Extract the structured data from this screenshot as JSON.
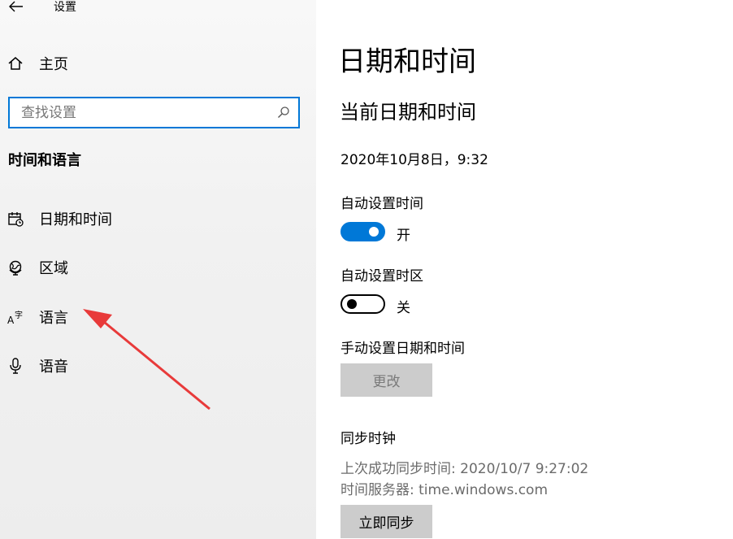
{
  "window": {
    "title": "设置"
  },
  "sidebar": {
    "home_label": "主页",
    "search": {
      "placeholder": "查找设置",
      "value": ""
    },
    "section_title": "时间和语言",
    "items": [
      {
        "label": "日期和时间",
        "icon": "calendar-clock-icon"
      },
      {
        "label": "区域",
        "icon": "globe-region-icon"
      },
      {
        "label": "语言",
        "icon": "language-icon"
      },
      {
        "label": "语音",
        "icon": "microphone-icon"
      }
    ]
  },
  "main": {
    "page_title": "日期和时间",
    "current_section_title": "当前日期和时间",
    "current_datetime": "2020年10月8日，9:32",
    "auto_time": {
      "label": "自动设置时间",
      "state_text": "开",
      "on": true
    },
    "auto_timezone": {
      "label": "自动设置时区",
      "state_text": "关",
      "on": false
    },
    "manual": {
      "label": "手动设置日期和时间",
      "button_label": "更改"
    },
    "sync": {
      "title": "同步时钟",
      "last_sync": "上次成功同步时间: 2020/10/7 9:27:02",
      "time_server": "时间服务器: time.windows.com",
      "button_label": "立即同步"
    }
  },
  "colors": {
    "accent": "#0078d7",
    "annotation_arrow": "#e83a3a"
  }
}
